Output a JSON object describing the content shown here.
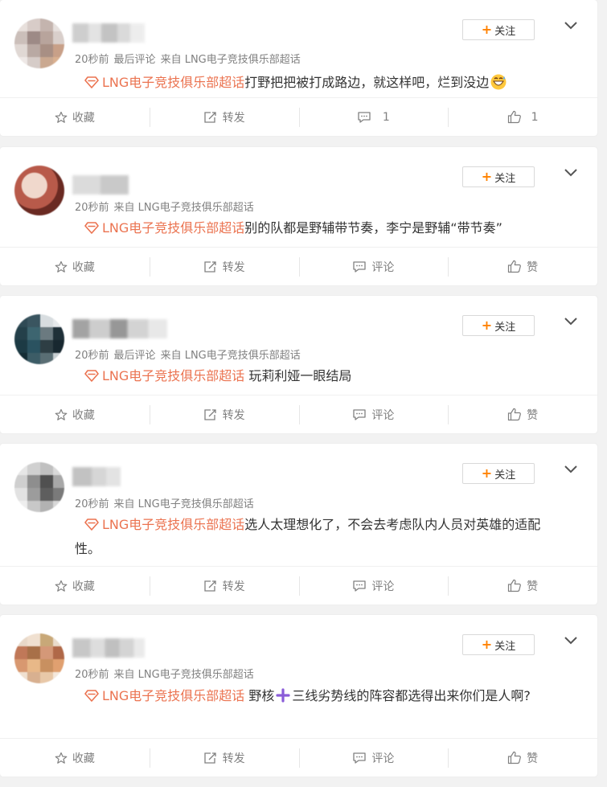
{
  "colors": {
    "accent": "#eb7350",
    "follow_plus": "#ff8200",
    "meta_text": "#808080",
    "purple_plus": "#8a5cd8"
  },
  "posts": [
    {
      "time": "20秒前",
      "last_comment": "最后评论",
      "source": "来自 LNG电子竞技俱乐部超话",
      "topic": "LNG电子竞技俱乐部超话",
      "text": "打野把把被打成路边，就这样吧，烂到没边",
      "emoji": "grinning-sweat-emoji",
      "follow_label": "关注",
      "actions": {
        "favorite": "收藏",
        "repost": "转发",
        "comment": "1",
        "like": "1"
      }
    },
    {
      "time": "20秒前",
      "last_comment": "",
      "source": "来自 LNG电子竞技俱乐部超话",
      "topic": "LNG电子竞技俱乐部超话",
      "text": "别的队都是野辅带节奏，李宁是野辅“带节奏”",
      "follow_label": "关注",
      "actions": {
        "favorite": "收藏",
        "repost": "转发",
        "comment": "评论",
        "like": "赞"
      }
    },
    {
      "time": "20秒前",
      "last_comment": "最后评论",
      "source": "来自 LNG电子竞技俱乐部超话",
      "topic": "LNG电子竞技俱乐部超话",
      "text": " 玩莉利娅一眼结局",
      "follow_label": "关注",
      "actions": {
        "favorite": "收藏",
        "repost": "转发",
        "comment": "评论",
        "like": "赞"
      }
    },
    {
      "time": "20秒前",
      "last_comment": "",
      "source": "来自 LNG电子竞技俱乐部超话",
      "topic": "LNG电子竞技俱乐部超话",
      "text": "选人太理想化了，不会去考虑队内人员对英雄的适配性。",
      "follow_label": "关注",
      "actions": {
        "favorite": "收藏",
        "repost": "转发",
        "comment": "评论",
        "like": "赞"
      }
    },
    {
      "time": "20秒前",
      "last_comment": "",
      "source": "来自 LNG电子竞技俱乐部超话",
      "topic": "LNG电子竞技俱乐部超话",
      "text_before": " 野核",
      "text_after": "三线劣势线的阵容都选得出来你们是人啊?",
      "follow_label": "关注",
      "actions": {
        "favorite": "收藏",
        "repost": "转发",
        "comment": "评论",
        "like": "赞"
      }
    }
  ]
}
